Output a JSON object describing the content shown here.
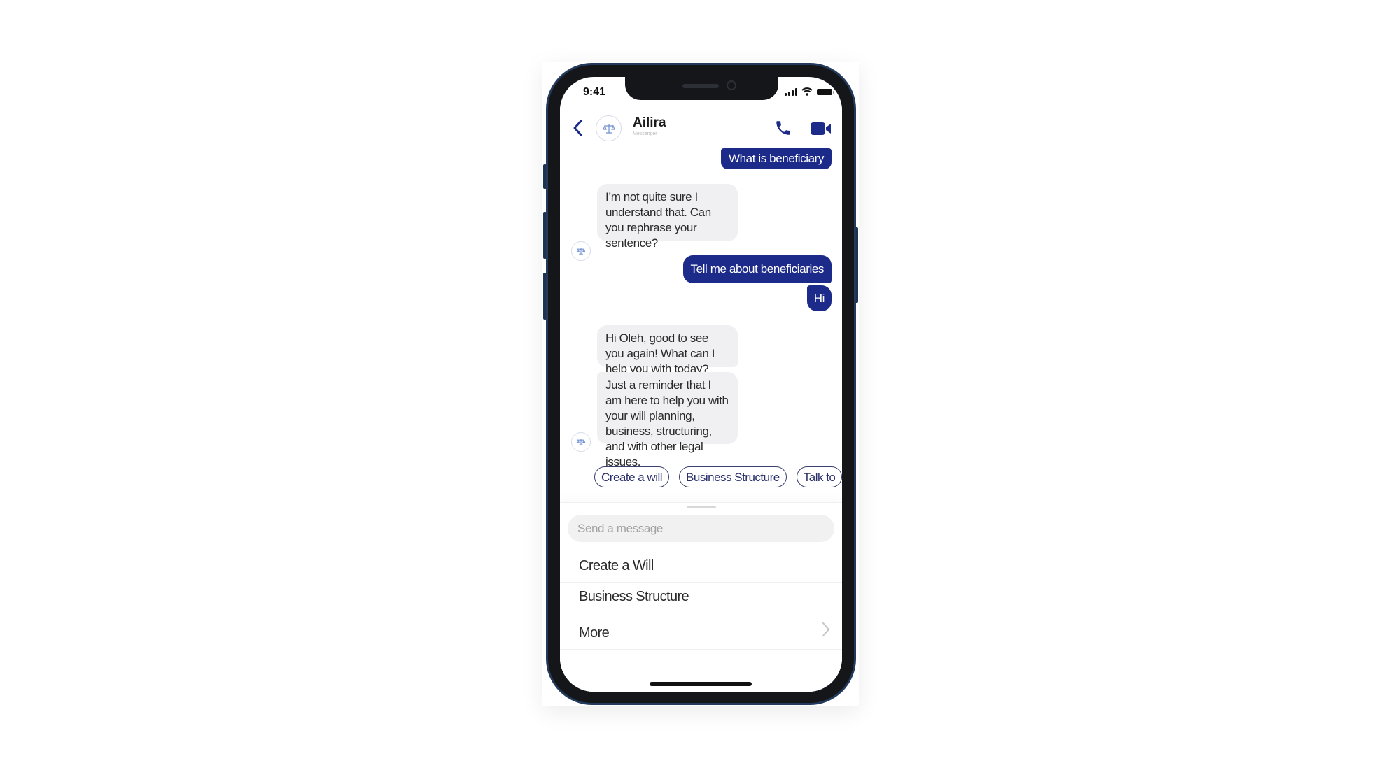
{
  "status_bar": {
    "time": "9:41"
  },
  "header": {
    "title": "Ailira",
    "subtitle": "Messenger",
    "icons": {
      "back": "chevron-left-icon",
      "avatar": "scales-icon",
      "call": "phone-icon",
      "video": "video-camera-icon"
    }
  },
  "colors": {
    "accent": "#1c2a8a",
    "incoming_bubble": "#f0f0f2",
    "chip_border": "#3a3f6e"
  },
  "messages": [
    {
      "from": "user",
      "text": "What is beneficiary"
    },
    {
      "from": "bot",
      "text": "I’m not quite sure I understand that. Can you rephrase your sentence?"
    },
    {
      "from": "user",
      "text": "Tell me about beneficiaries"
    },
    {
      "from": "user",
      "text": "Hi"
    },
    {
      "from": "bot",
      "text": "Hi Oleh, good to see you again! What can I help you with today?"
    },
    {
      "from": "bot",
      "text": "Just a reminder that I am here to help you with your will planning, business, structuring, and with other legal issues."
    }
  ],
  "quick_replies": [
    "Create a will",
    "Business Structure",
    "Talk to"
  ],
  "composer": {
    "placeholder": "Send a message",
    "value": ""
  },
  "menu": {
    "items": [
      {
        "label": "Create a Will"
      },
      {
        "label": "Business Structure"
      },
      {
        "label": "More",
        "icon": "chevron-right-icon"
      }
    ]
  }
}
